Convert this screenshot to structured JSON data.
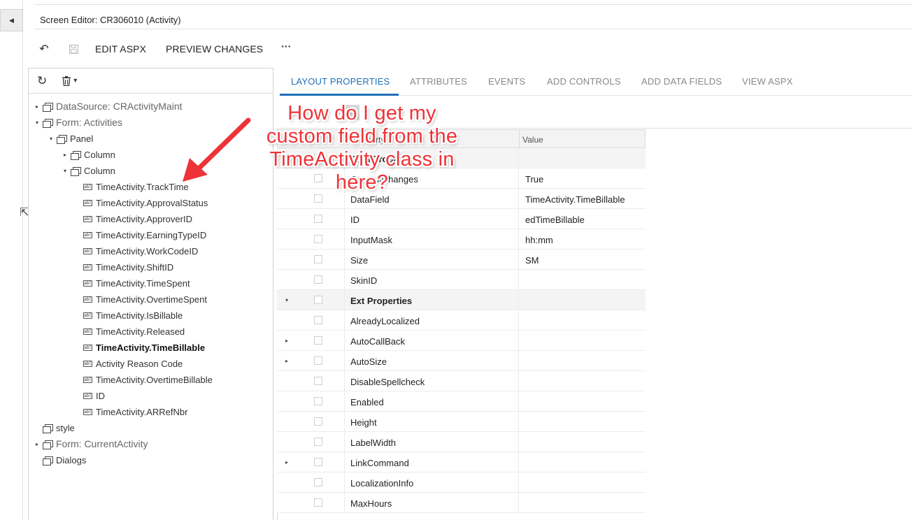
{
  "window": {
    "title": "Screen Editor: CR306010 (Activity)",
    "collapse_glyph": "◀"
  },
  "toolbar": {
    "undo_icon": "↶",
    "save_icon": "🖫",
    "edit_aspx_label": "EDIT ASPX",
    "preview_changes_label": "PREVIEW CHANGES",
    "more_label": "···"
  },
  "tree_tools": {
    "refresh_icon": "↻",
    "delete_icon": "🗑",
    "delete_caret": "▾"
  },
  "tree": {
    "items": [
      {
        "label": "DataSource: CRActivityMaint",
        "style": "grey",
        "level": 0,
        "arrow": "▸",
        "icon": "container"
      },
      {
        "label": "Form: Activities",
        "style": "grey",
        "level": 0,
        "arrow": "▾",
        "icon": "container"
      },
      {
        "label": "Panel",
        "style": "",
        "level": 1,
        "arrow": "▾",
        "icon": "container"
      },
      {
        "label": "Column",
        "style": "",
        "level": 2,
        "arrow": "▸",
        "icon": "container"
      },
      {
        "label": "Column",
        "style": "",
        "level": 2,
        "arrow": "▾",
        "icon": "container"
      },
      {
        "label": "TimeActivity.TrackTime",
        "style": "",
        "level": 3,
        "arrow": "",
        "icon": "field"
      },
      {
        "label": "TimeActivity.ApprovalStatus",
        "style": "",
        "level": 3,
        "arrow": "",
        "icon": "field"
      },
      {
        "label": "TimeActivity.ApproverID",
        "style": "",
        "level": 3,
        "arrow": "",
        "icon": "field"
      },
      {
        "label": "TimeActivity.EarningTypeID",
        "style": "",
        "level": 3,
        "arrow": "",
        "icon": "field"
      },
      {
        "label": "TimeActivity.WorkCodeID",
        "style": "",
        "level": 3,
        "arrow": "",
        "icon": "field"
      },
      {
        "label": "TimeActivity.ShiftID",
        "style": "",
        "level": 3,
        "arrow": "",
        "icon": "field"
      },
      {
        "label": "TimeActivity.TimeSpent",
        "style": "",
        "level": 3,
        "arrow": "",
        "icon": "field"
      },
      {
        "label": "TimeActivity.OvertimeSpent",
        "style": "",
        "level": 3,
        "arrow": "",
        "icon": "field"
      },
      {
        "label": "TimeActivity.IsBillable",
        "style": "",
        "level": 3,
        "arrow": "",
        "icon": "field"
      },
      {
        "label": "TimeActivity.Released",
        "style": "",
        "level": 3,
        "arrow": "",
        "icon": "field"
      },
      {
        "label": "TimeActivity.TimeBillable",
        "style": "bold",
        "level": 3,
        "arrow": "",
        "icon": "field"
      },
      {
        "label": "Activity Reason Code",
        "style": "",
        "level": 3,
        "arrow": "",
        "icon": "field"
      },
      {
        "label": "TimeActivity.OvertimeBillable",
        "style": "",
        "level": 3,
        "arrow": "",
        "icon": "field"
      },
      {
        "label": "ID",
        "style": "",
        "level": 3,
        "arrow": "",
        "icon": "field"
      },
      {
        "label": "TimeActivity.ARRefNbr",
        "style": "",
        "level": 3,
        "arrow": "",
        "icon": "field"
      },
      {
        "label": "style",
        "style": "",
        "level": 0,
        "arrow": "",
        "icon": "container"
      },
      {
        "label": "Form: CurrentActivity",
        "style": "grey",
        "level": 0,
        "arrow": "▸",
        "icon": "container"
      },
      {
        "label": "Dialogs",
        "style": "",
        "level": 0,
        "arrow": "",
        "icon": "container"
      }
    ]
  },
  "tabs": [
    {
      "label": "LAYOUT PROPERTIES",
      "active": true
    },
    {
      "label": "ATTRIBUTES",
      "active": false
    },
    {
      "label": "EVENTS",
      "active": false
    },
    {
      "label": "ADD CONTROLS",
      "active": false
    },
    {
      "label": "ADD DATA FIELDS",
      "active": false
    },
    {
      "label": "VIEW ASPX",
      "active": false
    }
  ],
  "grid": {
    "header_property": "Property",
    "header_value": "Value",
    "rows": [
      {
        "name": "Data Properties",
        "value": "",
        "section": true,
        "exp": "▾"
      },
      {
        "name": "CommitChanges",
        "value": "True",
        "section": false,
        "exp": ""
      },
      {
        "name": "DataField",
        "value": "TimeActivity.TimeBillable",
        "section": false,
        "exp": ""
      },
      {
        "name": "ID",
        "value": "edTimeBillable",
        "section": false,
        "exp": ""
      },
      {
        "name": "InputMask",
        "value": "hh:mm",
        "section": false,
        "exp": ""
      },
      {
        "name": "Size",
        "value": "SM",
        "section": false,
        "exp": ""
      },
      {
        "name": "SkinID",
        "value": "",
        "section": false,
        "exp": ""
      },
      {
        "name": "Ext Properties",
        "value": "",
        "section": true,
        "exp": "▾"
      },
      {
        "name": "AlreadyLocalized",
        "value": "",
        "section": false,
        "exp": ""
      },
      {
        "name": "AutoCallBack",
        "value": "",
        "section": false,
        "exp": "▸"
      },
      {
        "name": "AutoSize",
        "value": "",
        "section": false,
        "exp": "▸"
      },
      {
        "name": "DisableSpellcheck",
        "value": "",
        "section": false,
        "exp": ""
      },
      {
        "name": "Enabled",
        "value": "",
        "section": false,
        "exp": ""
      },
      {
        "name": "Height",
        "value": "",
        "section": false,
        "exp": ""
      },
      {
        "name": "LabelWidth",
        "value": "",
        "section": false,
        "exp": ""
      },
      {
        "name": "LinkCommand",
        "value": "",
        "section": false,
        "exp": "▸"
      },
      {
        "name": "LocalizationInfo",
        "value": "",
        "section": false,
        "exp": ""
      },
      {
        "name": "MaxHours",
        "value": "",
        "section": false,
        "exp": ""
      }
    ]
  },
  "annotation": {
    "text_lines": [
      "How do I get my",
      "custom field from the",
      "TimeActivity class in",
      "here?"
    ],
    "color": "#ee3338"
  },
  "colors": {
    "accent": "#1d6fb8",
    "annotation_red": "#ee3338"
  }
}
